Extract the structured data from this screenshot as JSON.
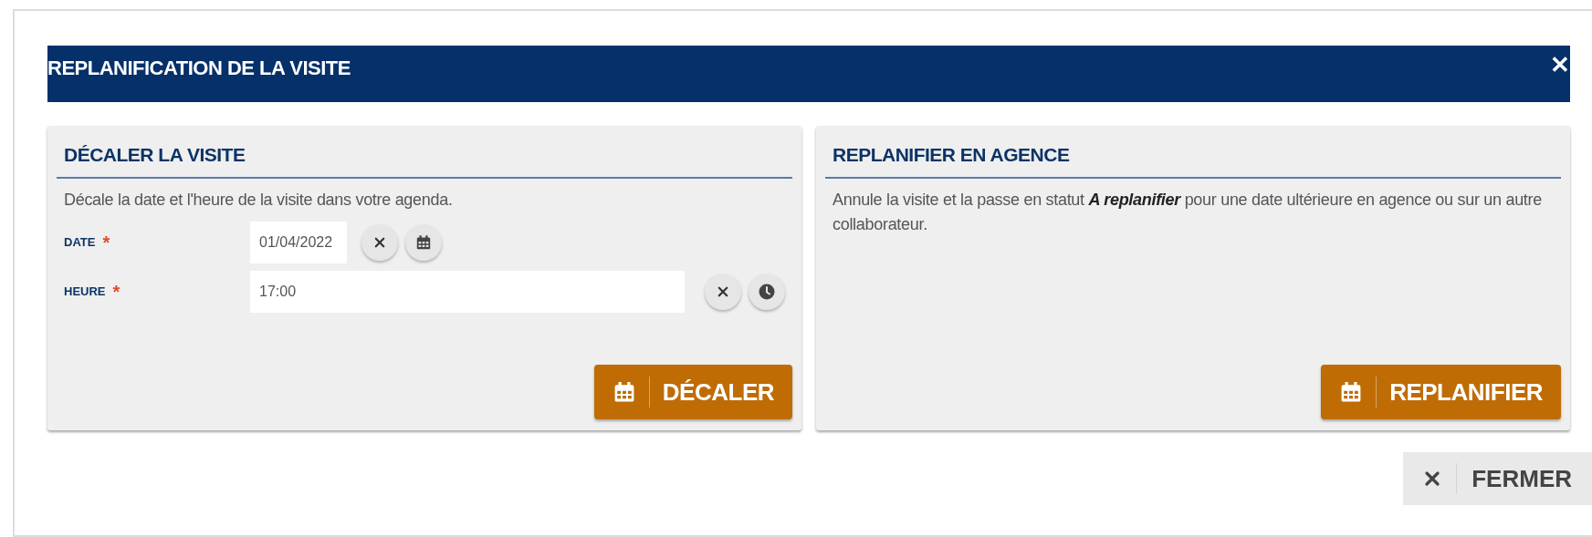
{
  "dialog": {
    "title": "REPLANIFICATION DE LA VISITE",
    "close": "✕"
  },
  "panels": [
    {
      "title": "DÉCALER LA VISITE",
      "description": "Décale la date et l'heure de la visite dans votre agenda.",
      "fields": [
        {
          "kind": "date",
          "label": "DATE",
          "required": true,
          "required_mark": "*",
          "value": "01/04/2022"
        },
        {
          "kind": "time",
          "label": "HEURE",
          "required": true,
          "required_mark": "*",
          "value": "17:00"
        }
      ],
      "action": "DÉCALER"
    },
    {
      "title": "REPLANIFIER EN AGENCE",
      "description": "Annule la visite et la passe en statut **A replanifier** pour une date ultérieure en agence ou sur un autre collaborateur.",
      "action": "REPLANIFIER"
    }
  ],
  "footer": {
    "close_button": "FERMER"
  }
}
